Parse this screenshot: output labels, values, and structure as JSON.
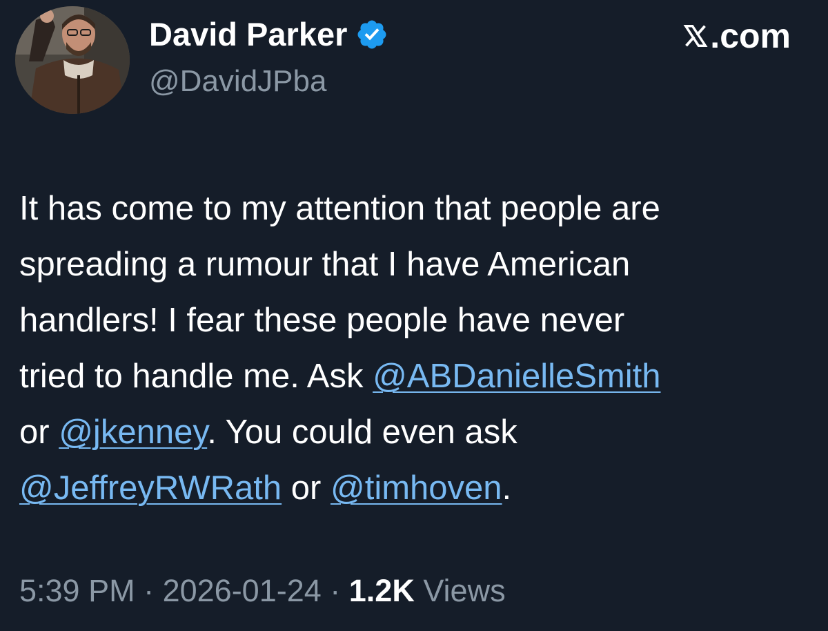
{
  "user": {
    "display_name": "David Parker",
    "handle": "@DavidJPba",
    "verified": true
  },
  "brand": {
    "label": ".com",
    "icon": "x-logo-icon"
  },
  "tweet": {
    "lines": [
      [
        {
          "text": "It has come to my attention that people are"
        }
      ],
      [
        {
          "text": "spreading a rumour that I have American"
        }
      ],
      [
        {
          "text": "handlers! I fear these people have never"
        }
      ],
      [
        {
          "text": "tried to handle me. Ask "
        },
        {
          "text": "@ABDanielleSmith",
          "mention": true
        }
      ],
      [
        {
          "text": "or "
        },
        {
          "text": "@jkenney",
          "mention": true
        },
        {
          "text": ". You could even ask"
        }
      ],
      [
        {
          "text": "@JeffreyRWRath",
          "mention": true
        },
        {
          "text": " or "
        },
        {
          "text": "@timhoven",
          "mention": true
        },
        {
          "text": "."
        }
      ]
    ]
  },
  "meta": {
    "time": "5:39 PM",
    "separator": " · ",
    "date": "2026-01-24",
    "views_count": "1.2K",
    "views_label": " Views"
  },
  "colors": {
    "background": "#151d29",
    "mention": "#78b9f2",
    "secondary_text": "#8b98a5",
    "verified": "#1d9bf0"
  }
}
